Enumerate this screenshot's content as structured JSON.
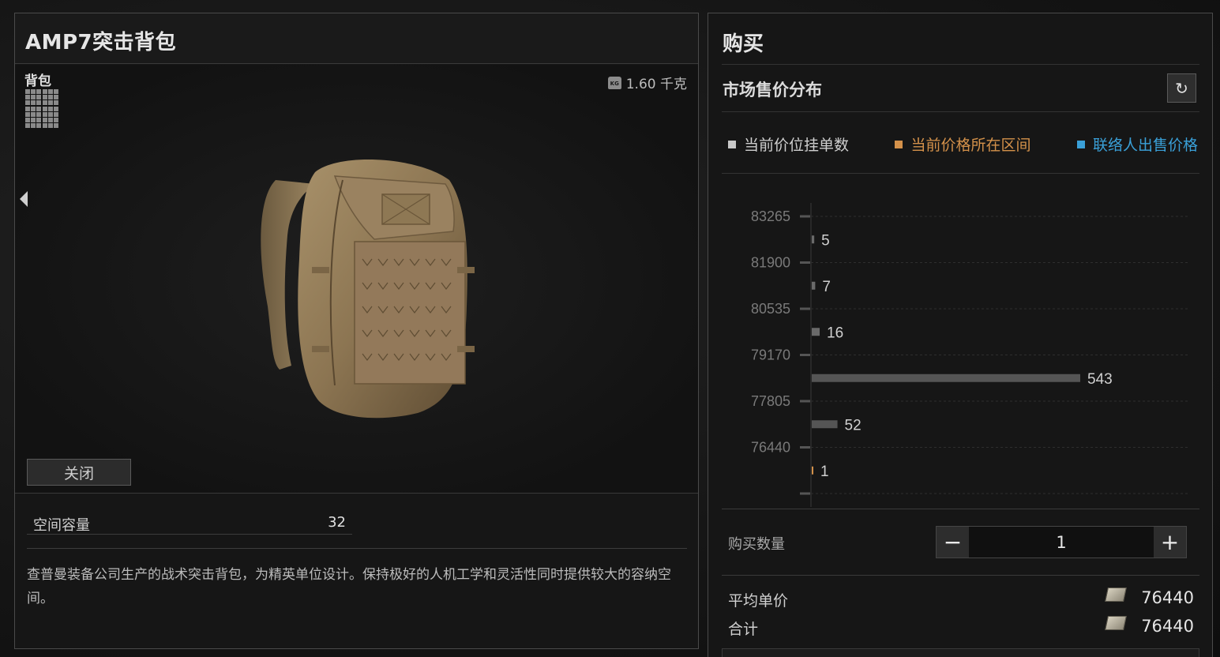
{
  "item": {
    "title": "AMP7突击背包",
    "category": "背包",
    "weight": "1.60 千克",
    "weight_icon_text": "KG",
    "close_label": "关闭",
    "capacity_label": "空间容量",
    "capacity_value": "32",
    "description": "查普曼装备公司生产的战术突击背包，为精英单位设计。保持极好的人机工学和灵活性同时提供较大的容纳空间。"
  },
  "buy": {
    "title": "购买",
    "market_title": "市场售价分布",
    "refresh_icon": "↻",
    "legend": [
      {
        "label": "当前价位挂单数",
        "color": "#c8c8c8"
      },
      {
        "label": "当前价格所在区间",
        "color": "#d4914a"
      },
      {
        "label": "联络人出售价格",
        "color": "#3aa0d8"
      }
    ],
    "quantity_label": "购买数量",
    "quantity_value": "1",
    "minus_label": "−",
    "plus_label": "+",
    "avg_price_label": "平均单价",
    "avg_price_value": "76440",
    "total_label": "合计",
    "total_value": "76440"
  },
  "chart_data": {
    "type": "bar",
    "orientation": "horizontal",
    "tick_labels": [
      "83265",
      "81900",
      "80535",
      "79170",
      "77805",
      "76440"
    ],
    "bars": [
      {
        "value": 5,
        "label": "5",
        "color": "#6a6a6a"
      },
      {
        "value": 7,
        "label": "7",
        "color": "#6a6a6a"
      },
      {
        "value": 16,
        "label": "16",
        "color": "#6a6a6a"
      },
      {
        "value": 543,
        "label": "543",
        "color": "#555555"
      },
      {
        "value": 52,
        "label": "52",
        "color": "#555555"
      },
      {
        "value": 1,
        "label": "1",
        "color": "#d4914a"
      }
    ],
    "xmax": 600,
    "grid": true
  }
}
